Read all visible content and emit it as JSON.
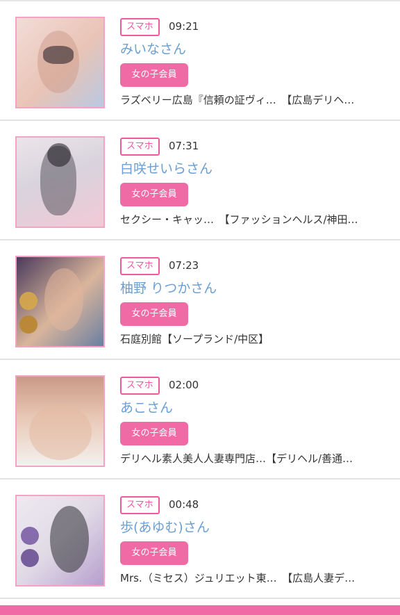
{
  "entries": [
    {
      "device": "スマホ",
      "time": "09:21",
      "name": "みいなさん",
      "member": "女の子会員",
      "shop": "ラズベリー広島『信頼の証ヴィ…　【広島デリヘ…",
      "thumb_colors": [
        "#f2dcd8",
        "#e9c4b6",
        "#b9c8e2"
      ]
    },
    {
      "device": "スマホ",
      "time": "07:31",
      "name": "白咲せいらさん",
      "member": "女の子会員",
      "shop": "セクシー・キャッ…　【ファッションヘルス/神田…",
      "thumb_colors": [
        "#ece4ea",
        "#5b5860",
        "#f2c9d6"
      ]
    },
    {
      "device": "スマホ",
      "time": "07:23",
      "name": "柚野 りつかさん",
      "member": "女の子会員",
      "shop": "石庭別館【ソープランド/中区】",
      "thumb_colors": [
        "#d9b59b",
        "#6b7fa3",
        "#4a3b5c"
      ]
    },
    {
      "device": "スマホ",
      "time": "02:00",
      "name": "あこさん",
      "member": "女の子会員",
      "shop": "デリヘル素人美人人妻専門店…【デリヘル/善通…",
      "thumb_colors": [
        "#e8c7b4",
        "#f3f1ef",
        "#c99a86"
      ]
    },
    {
      "device": "スマホ",
      "time": "00:48",
      "name": "歩(あゆむ)さん",
      "member": "女の子会員",
      "shop": "Mrs.（ミセス）ジュリエット東…　【広島人妻デ…",
      "thumb_colors": [
        "#eeeaf0",
        "#2e2d33",
        "#b79fcd"
      ]
    }
  ],
  "colors": {
    "accent_pink": "#f06aa6",
    "badge_border": "#ee5aa0",
    "name_blue": "#6a9fd4",
    "thumb_border": "#f4a3c6"
  }
}
